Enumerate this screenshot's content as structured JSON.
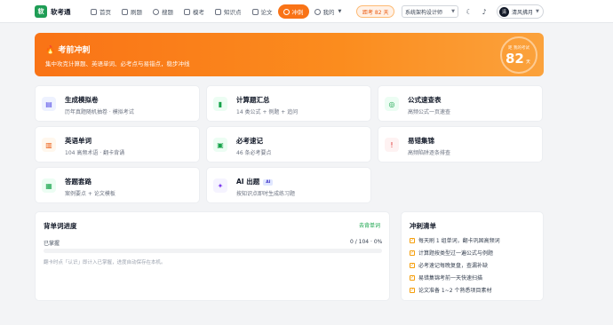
{
  "header": {
    "logo_char": "软",
    "app_name": "软考通",
    "nav": [
      {
        "label": "首页",
        "icon": "home-icon"
      },
      {
        "label": "刷题",
        "icon": "refresh-icon"
      },
      {
        "label": "搜题",
        "icon": "search-icon"
      },
      {
        "label": "模考",
        "icon": "exam-icon"
      },
      {
        "label": "知识点",
        "icon": "bookmark-icon"
      },
      {
        "label": "论文",
        "icon": "document-icon"
      },
      {
        "label": "冲刺",
        "icon": "clock-icon"
      },
      {
        "label": "我的",
        "icon": "user-icon"
      }
    ],
    "active_nav": "冲刺",
    "exam_countdown": "距考 82 天",
    "exam_select": "系统架构设计师",
    "user_name": "清风拂月",
    "user_initial": "清"
  },
  "hero": {
    "title": "考前冲刺",
    "subtitle": "集中攻克计算题、英语单词、必考点与易错点，稳步冲线",
    "ring_label": "距 我的考试",
    "days": "82",
    "unit": "天"
  },
  "cards": [
    {
      "title": "生成模拟卷",
      "sub": "历年真题随机抽卷 · 模拟考试",
      "icon": "paper-icon",
      "bg": "#eef2ff",
      "fg": "#4f46e5"
    },
    {
      "title": "计算题汇总",
      "sub": "14 类公式 + 例题 + 追问",
      "icon": "bar-chart-icon",
      "bg": "#ecfdf3",
      "fg": "#16a34a"
    },
    {
      "title": "公式速查表",
      "sub": "高频公式一页速查",
      "icon": "compass-icon",
      "bg": "#ecfdf3",
      "fg": "#16a34a"
    },
    {
      "title": "英语单词",
      "sub": "104 高频术语 · 翻卡背诵",
      "icon": "book-icon",
      "bg": "#fff7ed",
      "fg": "#ea580c"
    },
    {
      "title": "必考速记",
      "sub": "46 条必考要点",
      "icon": "notebook-icon",
      "bg": "#ecfdf3",
      "fg": "#16a34a"
    },
    {
      "title": "易错集锦",
      "sub": "高频陷阱逐条排查",
      "icon": "alert-icon",
      "bg": "#fef2f2",
      "fg": "#dc2626"
    },
    {
      "title": "答题套路",
      "sub": "案例要点 + 论文模板",
      "icon": "clipboard-icon",
      "bg": "#ecfdf3",
      "fg": "#16a34a"
    },
    {
      "title": "AI 出题",
      "sub": "按知识点即时生成练习题",
      "icon": "sparkle-icon",
      "bg": "#f5f3ff",
      "fg": "#7c3aed",
      "tag": "AI"
    }
  ],
  "progress": {
    "title": "背单词进度",
    "link": "去背单词",
    "label": "已掌握",
    "value": "0 / 104 · 0%",
    "fraction": 0,
    "note": "翻卡时点「认识」即计入已掌握，进度自动保存在本机。"
  },
  "checklist": {
    "title": "冲刺清单",
    "items": [
      "每天刷 1 组单词，翻卡巩固高频词",
      "计算题按类型过一遍公式与例题",
      "必考速记每晚复盘，查漏补缺",
      "易错集锦考前一天快速扫描",
      "论文准备 1~2 个熟悉项目素材"
    ]
  },
  "colors": {
    "accent": "#f97316",
    "success": "#22c55e"
  }
}
